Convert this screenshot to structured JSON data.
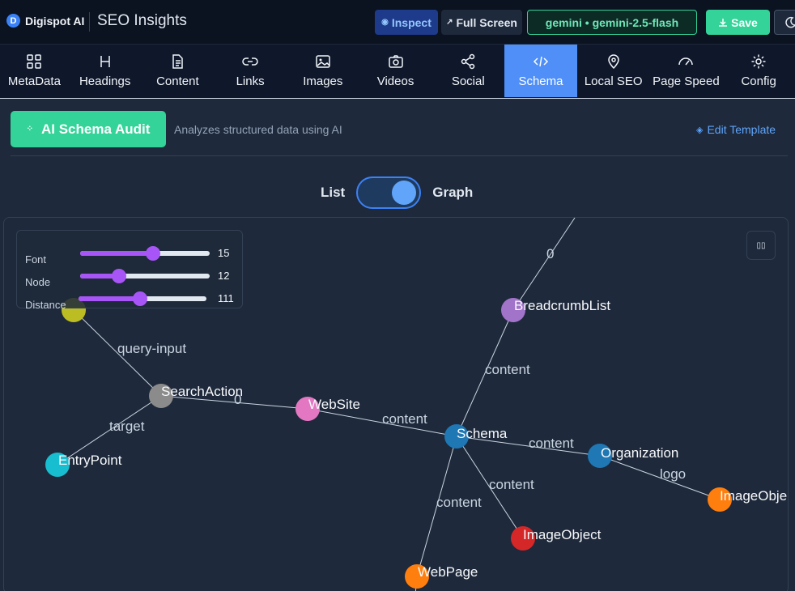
{
  "header": {
    "brand": "Digispot AI",
    "brand_initial": "D",
    "title": "SEO Insights",
    "inspect_label": "Inspect",
    "fullscreen_label": "Full Screen",
    "model_label": "gemini • gemini-2.5-flash",
    "save_label": "Save"
  },
  "tabs": [
    {
      "label": "MetaData",
      "icon": "grid-icon"
    },
    {
      "label": "Headings",
      "icon": "heading-icon"
    },
    {
      "label": "Content",
      "icon": "document-icon"
    },
    {
      "label": "Links",
      "icon": "link-icon"
    },
    {
      "label": "Images",
      "icon": "image-icon"
    },
    {
      "label": "Videos",
      "icon": "camera-icon"
    },
    {
      "label": "Social",
      "icon": "share-icon"
    },
    {
      "label": "Schema",
      "icon": "code-icon",
      "active": true
    },
    {
      "label": "Local SEO",
      "icon": "map-pin-icon"
    },
    {
      "label": "Page Speed",
      "icon": "gauge-icon"
    },
    {
      "label": "Config",
      "icon": "gear-icon"
    }
  ],
  "audit": {
    "button_label": "AI Schema Audit",
    "description": "Analyzes structured data using AI",
    "edit_template_label": "Edit Template"
  },
  "view_toggle": {
    "left_label": "List",
    "right_label": "Graph",
    "selected": "Graph"
  },
  "graph_controls": {
    "font": {
      "label": "Font",
      "value": "15",
      "fraction": 0.56
    },
    "node": {
      "label": "Node",
      "value": "12",
      "fraction": 0.3
    },
    "distance": {
      "label": "Distance",
      "value": "111",
      "fraction": 0.48
    }
  },
  "graph": {
    "nodes": [
      {
        "id": "breadcrumb",
        "label": "BreadcrumbList",
        "color": "#a173c9"
      },
      {
        "id": "search_action",
        "label": "SearchAction",
        "color": "#8b8b8b"
      },
      {
        "id": "website",
        "label": "WebSite",
        "color": "#e377c2"
      },
      {
        "id": "schema",
        "label": "Schema",
        "color": "#1f77b4"
      },
      {
        "id": "organization",
        "label": "Organization",
        "color": "#1f77b4"
      },
      {
        "id": "image_object_2",
        "label": "ImageObje",
        "color": "#ff7f0e"
      },
      {
        "id": "image_object",
        "label": "ImageObject",
        "color": "#d62728"
      },
      {
        "id": "webpage",
        "label": "WebPage",
        "color": "#ff7f0e"
      },
      {
        "id": "entry_point",
        "label": "EntryPoint",
        "color": "#17becf"
      },
      {
        "id": "query_input_node",
        "label": "",
        "color": "#bcbd22"
      }
    ],
    "edges": [
      {
        "from": "offscreen_top",
        "to": "breadcrumb",
        "label": "0"
      },
      {
        "from": "schema",
        "to": "breadcrumb",
        "label": "content"
      },
      {
        "from": "search_action",
        "to": "query_input_node",
        "label": "query-input"
      },
      {
        "from": "search_action",
        "to": "website",
        "label": "0"
      },
      {
        "from": "search_action",
        "to": "entry_point",
        "label": "target"
      },
      {
        "from": "website",
        "to": "schema",
        "label": "content"
      },
      {
        "from": "schema",
        "to": "organization",
        "label": "content"
      },
      {
        "from": "organization",
        "to": "image_object_2",
        "label": "logo"
      },
      {
        "from": "schema",
        "to": "image_object",
        "label": "content"
      },
      {
        "from": "schema",
        "to": "webpage",
        "label": "content"
      }
    ]
  }
}
